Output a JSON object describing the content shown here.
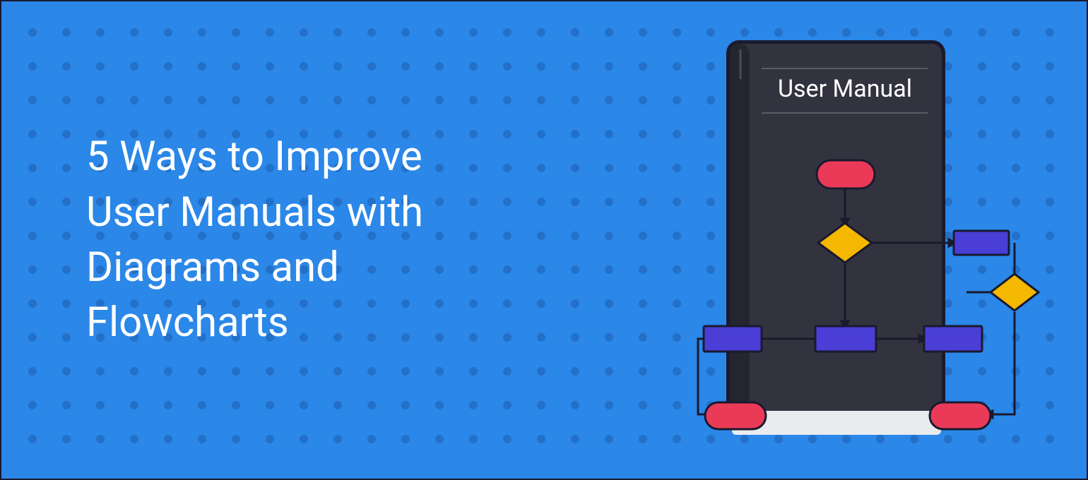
{
  "headline_line1": "5 Ways to Improve",
  "headline_line2": "User Manuals with",
  "headline_line3": "Diagrams and",
  "headline_line4": "Flowcharts",
  "book": {
    "title": "User Manual"
  },
  "colors": {
    "background": "#2b87e8",
    "book_cover": "#32333f",
    "book_spine": "#24252e",
    "book_pages": "#e9ecef",
    "flow_terminal": "#ea3a58",
    "flow_decision": "#f5b800",
    "flow_process": "#4a3ed6",
    "flow_line": "#1a1a2e",
    "text": "#ffffff"
  }
}
